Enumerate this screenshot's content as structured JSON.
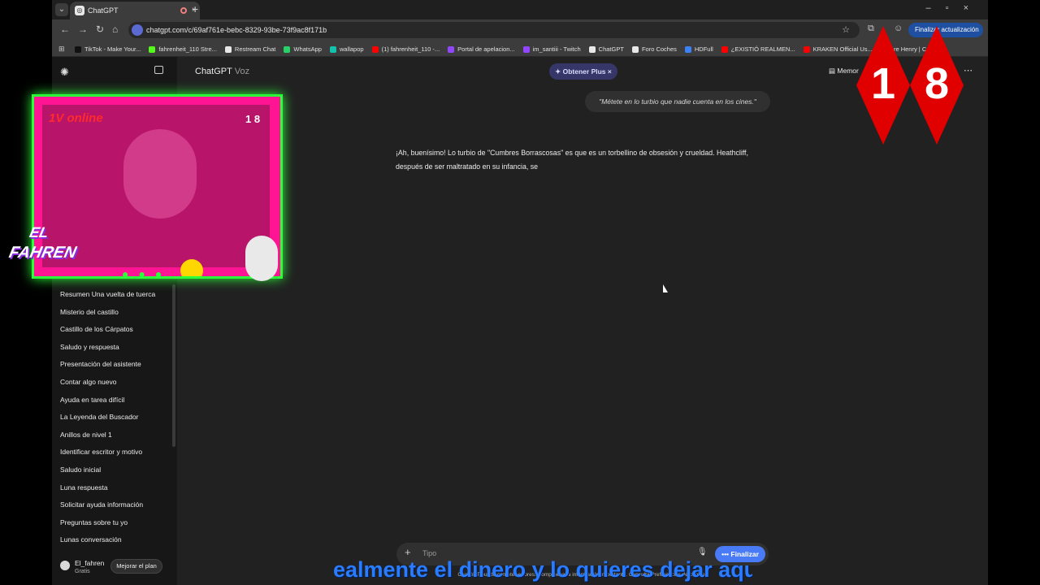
{
  "browser": {
    "tab_title": "ChatGPT",
    "url": "chatgpt.com/c/69af761e-bebc-8329-93be-73f9ac8f171b",
    "update_label": "Finalizar actualización",
    "bookmarks": [
      {
        "label": "TikTok - Make Your...",
        "color": "#111111"
      },
      {
        "label": "fahrenheit_110 Stre...",
        "color": "#53fc18"
      },
      {
        "label": "Restream Chat",
        "color": "#e8e8e8"
      },
      {
        "label": "WhatsApp",
        "color": "#25d366"
      },
      {
        "label": "wallapop",
        "color": "#13c1ac"
      },
      {
        "label": "(1) fahrenheit_110 -...",
        "color": "#ff0000"
      },
      {
        "label": "Portal de apelacion...",
        "color": "#9146ff"
      },
      {
        "label": "im_santiii - Twitch",
        "color": "#9146ff"
      },
      {
        "label": "ChatGPT",
        "color": "#e8e8e8"
      },
      {
        "label": "Foro Coches",
        "color": "#e8e8e8"
      },
      {
        "label": "HDFull",
        "color": "#3b82f6"
      },
      {
        "label": "¿EXISTIÓ REALMEN...",
        "color": "#ff0000"
      },
      {
        "label": "KRAKEN Official Us...",
        "color": "#ff0000"
      },
      {
        "label": "ore Henry | C...",
        "color": "#ff0000"
      }
    ]
  },
  "sidebar": {
    "items": [
      "Resumen Una vuelta de tuerca",
      "Misterio del castillo",
      "Castillo de los Cárpatos",
      "Saludo y respuesta",
      "Presentación del asistente",
      "Contar algo nuevo",
      "Ayuda en tarea difícil",
      "La Leyenda del Buscador",
      "Anillos de nivel 1",
      "Identificar escritor y motivo",
      "Saludo inicial",
      "Luna respuesta",
      "Solicitar ayuda información",
      "Preguntas sobre tu yo",
      "Lunas conversación"
    ],
    "user_name": "El_fahren",
    "user_plan": "Gratis",
    "upgrade_label": "Mejorar el plan"
  },
  "main": {
    "title": "ChatGPT",
    "title_suffix": "Voz",
    "plus_label": "Obtener Plus",
    "memory_label": "Memor",
    "user_message": "\"Métete en lo turbio que nadie cuenta en los cines.\"",
    "assistant_message": "¡Ah, buenísimo! Lo turbio de \"Cumbres Borrascosas\" es que es un torbellino de obsesión y crueldad. Heathcliff, después de ser maltratado en su infancia, se",
    "composer_placeholder": "Tipo",
    "finish_label": "Finalizar",
    "disclaimer": "ChatGPT puede cometer errores. Comprueba la información importante. Consulta Preferencias de cookies."
  },
  "overlay": {
    "cam_text": "1V online",
    "cam_badge": "1 8",
    "logo_line1": "EL",
    "logo_line2": "FAHREN",
    "age_digit_1": "1",
    "age_digit_2": "8",
    "caption": "ealmente el dinero y lo quieres dejar aquí"
  }
}
